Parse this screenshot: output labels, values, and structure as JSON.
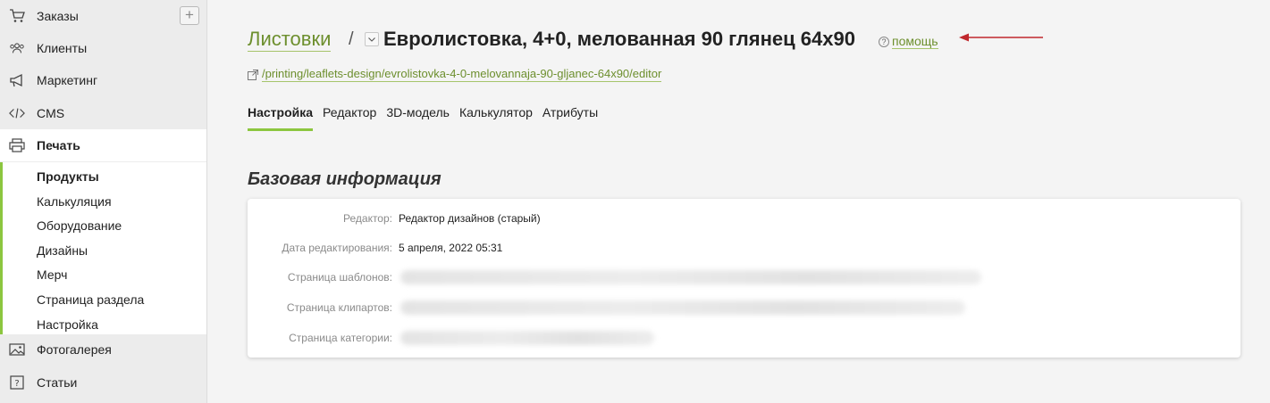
{
  "sidebar": {
    "items": [
      {
        "label": "Заказы",
        "icon": "cart-icon"
      },
      {
        "label": "Клиенты",
        "icon": "users-icon"
      },
      {
        "label": "Маркетинг",
        "icon": "megaphone-icon"
      },
      {
        "label": "CMS",
        "icon": "code-icon"
      },
      {
        "label": "Печать",
        "icon": "printer-icon"
      },
      {
        "label": "Фотогалерея",
        "icon": "image-icon"
      },
      {
        "label": "Статьи",
        "icon": "question-icon"
      }
    ],
    "add_label": "+",
    "subitems": [
      "Продукты",
      "Калькуляция",
      "Оборудование",
      "Дизайны",
      "Мерч",
      "Страница раздела",
      "Настройка"
    ]
  },
  "header": {
    "breadcrumb": "Листовки",
    "separator": "/",
    "title": "Евролистовка, 4+0, мелованная 90 глянец 64x90",
    "help_label": "помощь",
    "help_icon_glyph": "?",
    "url": "/printing/leaflets-design/evrolistovka-4-0-melovannaja-90-gljanec-64x90/editor"
  },
  "tabs": [
    "Настройка",
    "Редактор",
    "3D-модель",
    "Калькулятор",
    "Атрибуты"
  ],
  "section": {
    "title": "Базовая информация",
    "rows": [
      {
        "key": "Редактор:",
        "value": "Редактор дизайнов (старый)"
      },
      {
        "key": "Дата редактирования:",
        "value": "5 апреля, 2022 05:31"
      },
      {
        "key": "Страница шаблонов:",
        "value": ""
      },
      {
        "key": "Страница клипартов:",
        "value": ""
      },
      {
        "key": "Страница категории:",
        "value": ""
      }
    ]
  },
  "colors": {
    "accent": "#8cc63f",
    "link": "#6d8f2e",
    "arrow": "#c0282d"
  }
}
